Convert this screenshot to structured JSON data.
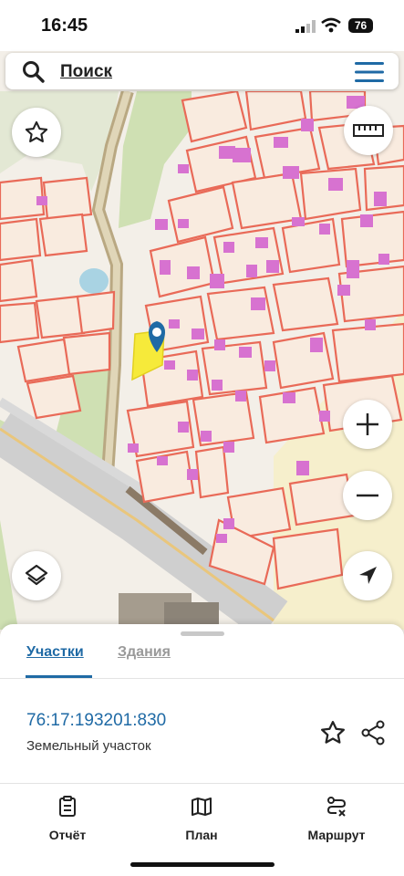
{
  "status_bar": {
    "time": "16:45",
    "battery": "76"
  },
  "search": {
    "label": "Поиск"
  },
  "map": {
    "parcel_fill": "#f9ebdf",
    "parcel_stroke": "#e96a58",
    "building_color": "#d772d0",
    "selected_color": "#f6ea3a",
    "marker_color": "#1f6aa5",
    "grass_color": "#cfe0b3"
  },
  "sheet": {
    "tabs": [
      {
        "label": "Участки",
        "active": true
      },
      {
        "label": "Здания",
        "active": false
      }
    ],
    "result": {
      "cadastral_number": "76:17:193201:830",
      "object_type": "Земельный участок"
    }
  },
  "bottom_nav": [
    {
      "label": "Отчёт",
      "icon": "report-icon"
    },
    {
      "label": "План",
      "icon": "map-plan-icon"
    },
    {
      "label": "Маршрут",
      "icon": "route-icon"
    }
  ],
  "accent_color": "#1f6aa5"
}
